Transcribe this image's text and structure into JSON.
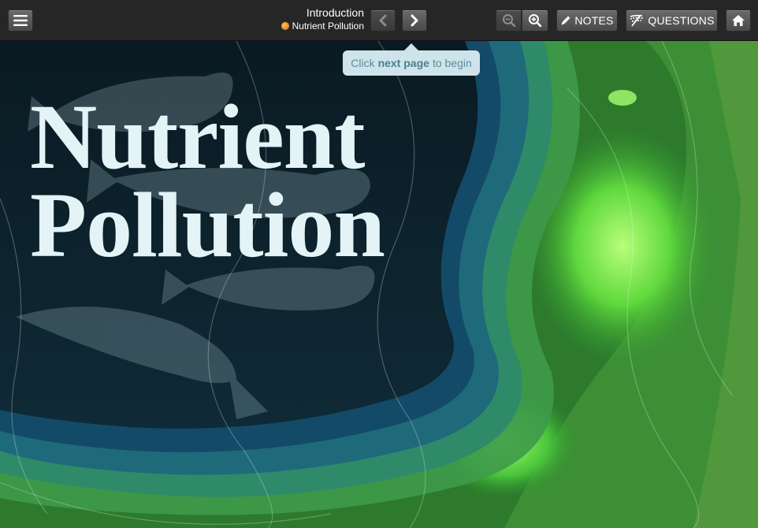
{
  "toolbar": {
    "menu_icon": "hamburger-menu-icon",
    "title": "Introduction",
    "subtitle": "Nutrient Pollution",
    "subtitle_icon": "book-icon",
    "prev_icon": "chevron-left-icon",
    "next_icon": "chevron-right-icon",
    "zoom_out_icon": "zoom-out-icon",
    "zoom_in_icon": "zoom-in-icon",
    "notes_label": "NOTES",
    "notes_icon": "pencil-icon",
    "questions_label": "QUESTIONS",
    "questions_icon": "questions-icon",
    "home_icon": "home-icon"
  },
  "hint": {
    "prefix": "Click",
    "emphasis": "next page",
    "suffix": "to begin"
  },
  "cover": {
    "line1": "Nutrient",
    "line2": "Pollution"
  },
  "colors": {
    "toolbar_bg": "#262626",
    "title_text": "#e3f3f6",
    "deep_water": "#0b1c24",
    "algae_green": "#3aa63a",
    "bloom_green": "#7ff35a",
    "hint_bg": "#cfe3ea"
  }
}
